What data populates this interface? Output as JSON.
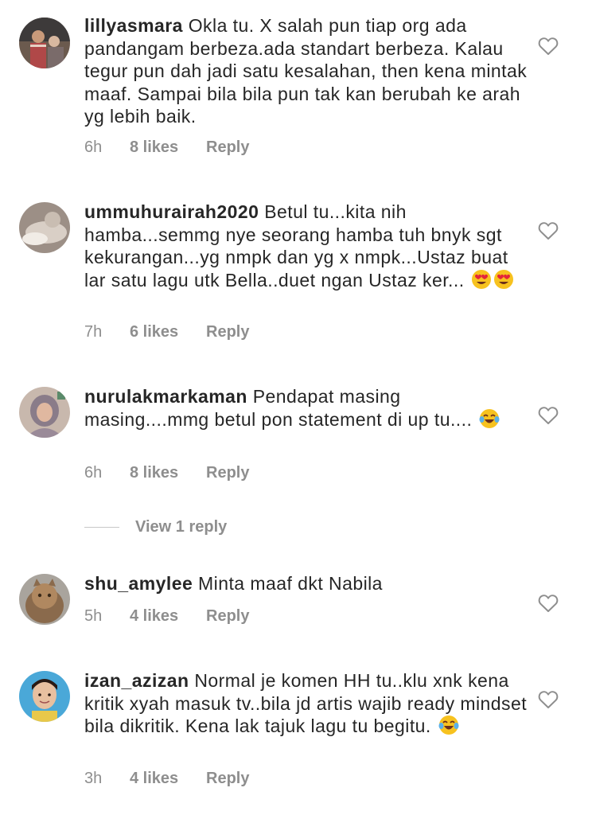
{
  "comments": [
    {
      "username": "lillyasmara",
      "text": "Okla tu. X salah pun tiap org ada pandangam berbeza.ada standart berbeza. Kalau  tegur pun dah jadi satu kesalahan, then kena mintak maaf. Sampai bila bila pun tak kan berubah ke arah yg lebih baik.",
      "time": "6h",
      "likes": "8 likes",
      "reply_label": "Reply",
      "emojis": []
    },
    {
      "username": "ummuhurairah2020",
      "text": "Betul tu...kita nih hamba...semmg nye seorang hamba tuh bnyk sgt kekurangan...yg nmpk dan yg x nmpk...Ustaz buat lar satu lagu utk Bella..duet ngan Ustaz ker...",
      "time": "7h",
      "likes": "6 likes",
      "reply_label": "Reply",
      "emojis": [
        "heart-eyes-emoji",
        "heart-eyes-emoji"
      ]
    },
    {
      "username": "nurulakmarkaman",
      "text": "Pendapat masing masing....mmg betul pon statement di up tu....",
      "time": "6h",
      "likes": "8 likes",
      "reply_label": "Reply",
      "emojis": [
        "tears-of-joy-emoji"
      ]
    },
    {
      "username": "shu_amylee",
      "text": "Minta maaf dkt Nabila",
      "time": "5h",
      "likes": "4 likes",
      "reply_label": "Reply",
      "emojis": []
    },
    {
      "username": "izan_azizan",
      "text": "Normal je komen HH tu..klu xnk kena kritik xyah masuk tv..bila jd artis wajib ready mindset bila dikritik. Kena lak tajuk lagu tu begitu.",
      "time": "3h",
      "likes": "4 likes",
      "reply_label": "Reply",
      "emojis": [
        "tears-of-joy-emoji"
      ]
    }
  ],
  "view_replies": "View 1 reply",
  "colors": {
    "text": "#262626",
    "muted": "#8e8e8e",
    "divider": "#c7c7c7"
  },
  "icons": {
    "like": "heart-outline-icon"
  }
}
